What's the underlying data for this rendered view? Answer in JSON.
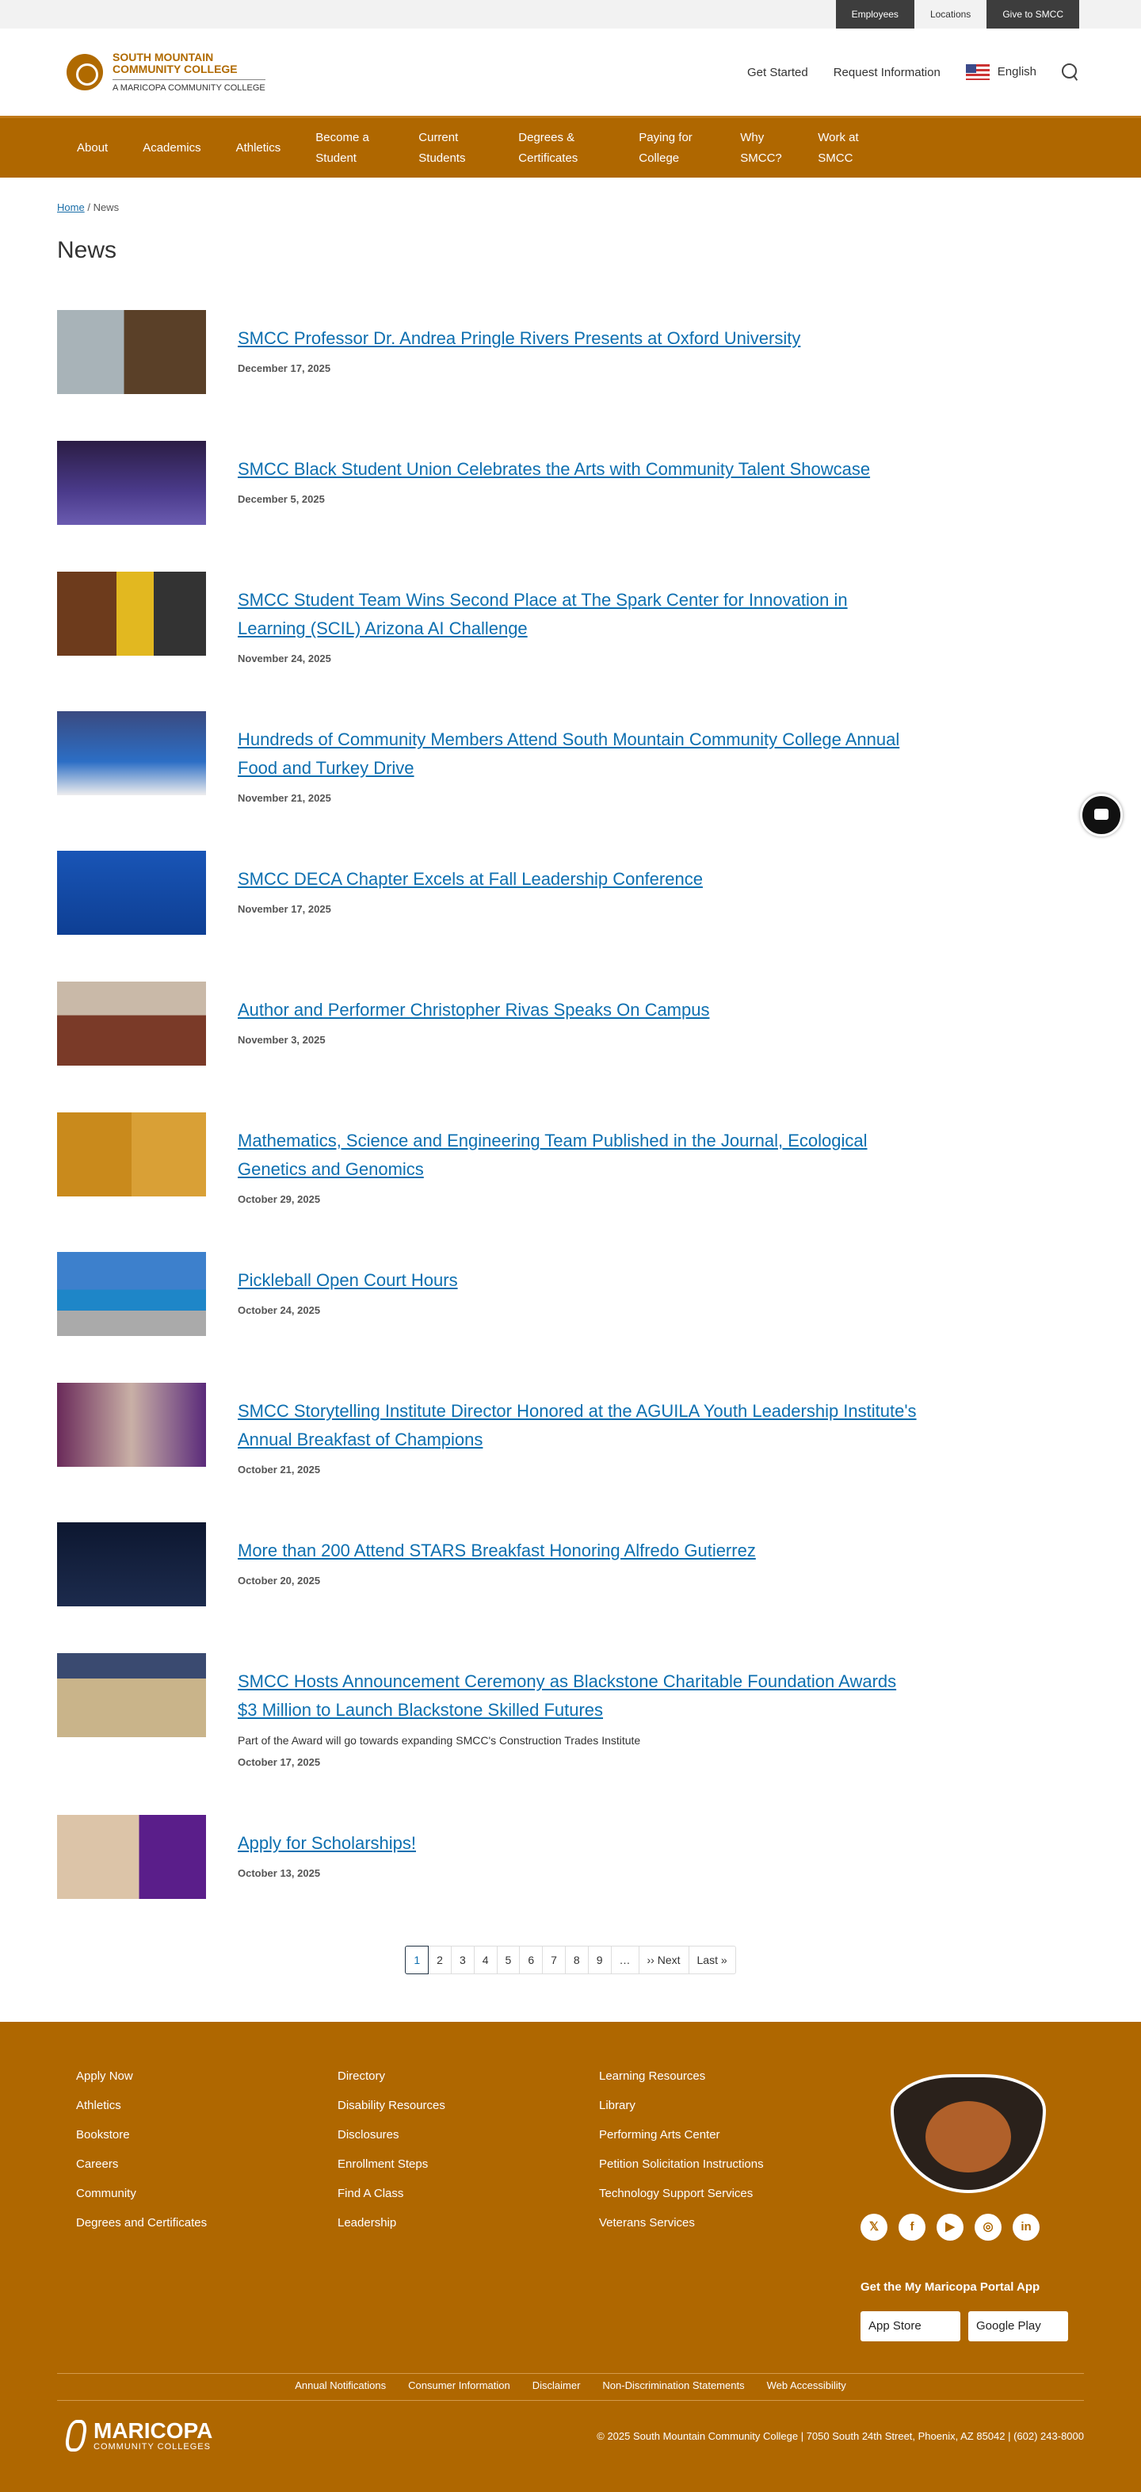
{
  "topbar": {
    "links": [
      "Employees",
      "Locations",
      "Give to SMCC"
    ]
  },
  "header": {
    "logo_line1": "SOUTH MOUNTAIN",
    "logo_line2": "COMMUNITY COLLEGE",
    "logo_sub": "A MARICOPA COMMUNITY COLLEGE",
    "get_started": "Get Started",
    "request_info": "Request Information",
    "language": "English"
  },
  "nav": [
    "About",
    "Academics",
    "Athletics",
    "Become a Student",
    "Current Students",
    "Degrees & Certificates",
    "Paying for College",
    "Why SMCC?",
    "Work at SMCC"
  ],
  "breadcrumb": {
    "home": "Home",
    "sep": "/",
    "current": "News"
  },
  "page_title": "News",
  "news": [
    {
      "title": "SMCC Professor Dr. Andrea Pringle Rivers Presents at Oxford University",
      "date": "December 17, 2025"
    },
    {
      "title": "SMCC Black Student Union Celebrates the Arts with Community Talent Showcase",
      "date": "December 5, 2025"
    },
    {
      "title": "SMCC Student Team Wins Second Place at The Spark Center for Innovation in Learning (SCIL) Arizona AI Challenge",
      "date": "November 24, 2025"
    },
    {
      "title": "Hundreds of Community Members Attend South Mountain Community College Annual Food and Turkey Drive",
      "date": "November 21, 2025"
    },
    {
      "title": "SMCC DECA Chapter Excels at Fall Leadership Conference",
      "date": "November 17, 2025"
    },
    {
      "title": "Author and Performer Christopher Rivas Speaks On Campus",
      "date": "November 3, 2025"
    },
    {
      "title": "Mathematics, Science and Engineering Team Published in the Journal, Ecological Genetics and Genomics",
      "date": "October 29, 2025"
    },
    {
      "title": "Pickleball Open Court Hours",
      "date": "October 24, 2025"
    },
    {
      "title": "SMCC Storytelling Institute Director Honored at the AGUILA Youth Leadership Institute's Annual Breakfast of Champions",
      "date": "October 21, 2025"
    },
    {
      "title": "More than 200 Attend STARS Breakfast Honoring Alfredo Gutierrez",
      "date": "October 20, 2025"
    },
    {
      "title": "SMCC Hosts Announcement Ceremony as Blackstone Charitable Foundation Awards $3 Million to Launch Blackstone Skilled Futures",
      "desc": "Part of the Award will go towards expanding SMCC's Construction Trades Institute",
      "date": "October 17, 2025"
    },
    {
      "title": "Apply for Scholarships!",
      "date": "October 13, 2025"
    }
  ],
  "pager": [
    "1",
    "2",
    "3",
    "4",
    "5",
    "6",
    "7",
    "8",
    "9",
    "…",
    "›› Next",
    "Last »"
  ],
  "footer": {
    "col1": [
      "Apply Now",
      "Athletics",
      "Bookstore",
      "Careers",
      "Community",
      "Degrees and Certificates"
    ],
    "col2": [
      "Directory",
      "Disability Resources",
      "Disclosures",
      "Enrollment Steps",
      "Find A Class",
      "Leadership"
    ],
    "col3": [
      "Learning Resources",
      "Library",
      "Performing Arts Center",
      "Petition Solicitation Instructions",
      "Technology Support Services",
      "Veterans Services"
    ],
    "social": [
      "𝕏",
      "f",
      "▶",
      "◎",
      "in"
    ],
    "app_heading": "Get the My Maricopa Portal App",
    "app_store": "App Store",
    "google_play": "Google Play",
    "bottom_links": [
      "Annual Notifications",
      "Consumer Information",
      "Disclaimer",
      "Non-Discrimination Statements",
      "Web Accessibility"
    ],
    "maricopa": "MARICOPA",
    "maricopa_sub": "COMMUNITY COLLEGES",
    "copyright": "© 2025 South Mountain Community College | 7050 South 24th Street, Phoenix, AZ 85042 | (602) 243-8000"
  }
}
